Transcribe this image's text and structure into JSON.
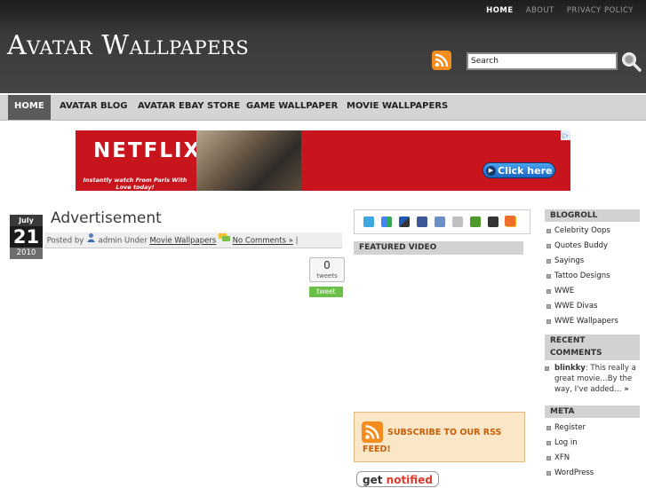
{
  "header": {
    "top_nav": [
      "HOME",
      "ABOUT",
      "PRIVACY POLICY"
    ],
    "site_title": "Avatar Wallpapers",
    "search": {
      "value": "Search"
    }
  },
  "main_nav": [
    "HOME",
    "AVATAR BLOG",
    "AVATAR EBAY STORE",
    "GAME WALLPAPER",
    "MOVIE WALLPAPERS"
  ],
  "banner": {
    "brand": "NETFLIX",
    "tagline": "Instantly watch From Paris With Love today!",
    "cta": "Click here"
  },
  "post": {
    "date": {
      "month": "July",
      "day": "21",
      "year": "2010"
    },
    "title": "Advertisement",
    "meta": {
      "posted_by": "Posted by",
      "author": "admin",
      "under": "Under",
      "category": "Movie Wallpapers",
      "comments": "No Comments »",
      "sep": "|"
    },
    "tweet_count": "0",
    "tweets_label": "tweets",
    "tweet_button": "tweet"
  },
  "middle": {
    "featured_video": "FEATURED VIDEO",
    "subscribe": "SUBSCRIBE TO OUR RSS FEED!",
    "get_notified": "get notified"
  },
  "sidebar": {
    "blogroll_title": "BLOGROLL",
    "blogroll": [
      "Celebrity Oops",
      "Quotes Buddy",
      "Sayings",
      "Tattoo Designs",
      "WWE",
      "WWE Divas",
      "WWE Wallpapers"
    ],
    "recent_title": "RECENT COMMENTS",
    "recent_author": "blinkky",
    "recent_text": ": This really a great movie…By the way, I've added…",
    "recent_more": "»",
    "meta_title": "META",
    "meta": [
      "Register",
      "Log in",
      "XFN",
      "WordPress"
    ]
  },
  "colors": {
    "header_bg": "#2c2c2c",
    "nav_bg": "#d4d4d4",
    "nav_active": "#5a5a5a",
    "rss_orange": "#f48c1e",
    "netflix_red": "#c8141c",
    "tweet_green": "#6cc04a"
  }
}
